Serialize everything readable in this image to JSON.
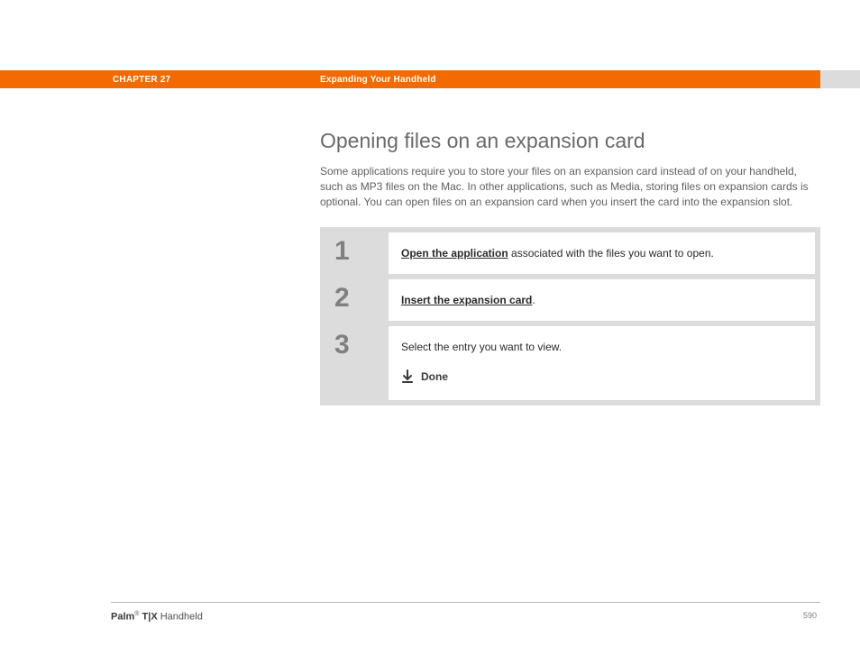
{
  "header": {
    "chapter_label": "CHAPTER 27",
    "chapter_title": "Expanding Your Handheld"
  },
  "main": {
    "heading": "Opening files on an expansion card",
    "intro": "Some applications require you to store your files on an expansion card instead of on your handheld, such as MP3 files on the Mac. In other applications, such as Media, storing files on expansion cards is optional. You can open files on an expansion card when you insert the card into the expansion slot.",
    "steps": [
      {
        "num": "1",
        "link": "Open the application",
        "after_link": " associated with the files you want to open."
      },
      {
        "num": "2",
        "link": "Insert the expansion card",
        "after_link": "."
      },
      {
        "num": "3",
        "text": "Select the entry you want to view.",
        "done_label": "Done"
      }
    ]
  },
  "footer": {
    "brand_bold": "Palm",
    "reg": "®",
    "model": " T|X",
    "product": " Handheld",
    "page": "590"
  }
}
